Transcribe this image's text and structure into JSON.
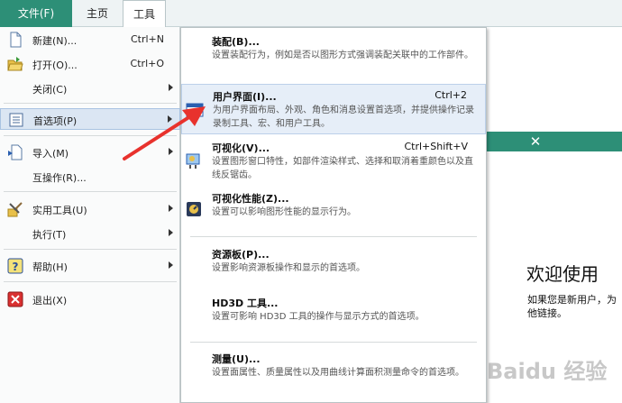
{
  "ribbon": {
    "tab_file": "文件(F)",
    "tab_home": "主页",
    "tab_tools": "工具"
  },
  "file_menu": {
    "items": [
      {
        "label": "新建(N)...",
        "shortcut": "Ctrl+N",
        "icon": "new-document-icon"
      },
      {
        "label": "打开(O)...",
        "shortcut": "Ctrl+O",
        "icon": "open-folder-icon"
      },
      {
        "label": "关闭(C)",
        "icon": "none"
      },
      {
        "label": "首选项(P)",
        "icon": "preferences-icon"
      },
      {
        "label": "导入(M)",
        "icon": "import-icon"
      },
      {
        "label": "互操作(R)...",
        "icon": "none"
      },
      {
        "label": "实用工具(U)",
        "icon": "utilities-icon"
      },
      {
        "label": "执行(T)",
        "icon": "none"
      },
      {
        "label": "帮助(H)",
        "icon": "help-icon"
      },
      {
        "label": "退出(X)",
        "icon": "exit-icon"
      }
    ]
  },
  "submenu": {
    "items": [
      {
        "title": "装配(B)...",
        "shortcut": "",
        "desc": "设置装配行为，例如是否以图形方式强调装配关联中的工作部件。"
      },
      {
        "title": "用户界面(I)...",
        "shortcut": "Ctrl+2",
        "desc": "为用户界面布局、外观、角色和消息设置首选项，并提供操作记录录制工具、宏、和用户工具。"
      },
      {
        "title": "可视化(V)...",
        "shortcut": "Ctrl+Shift+V",
        "desc": "设置图形窗口特性，如部件渲染样式、选择和取消着重颜色以及直线反锯齿。"
      },
      {
        "title": "可视化性能(Z)...",
        "shortcut": "",
        "desc": "设置可以影响图形性能的显示行为。"
      },
      {
        "title": "资源板(P)...",
        "shortcut": "",
        "desc": "设置影响资源板操作和显示的首选项。"
      },
      {
        "title": "HD3D 工具...",
        "shortcut": "",
        "desc": "设置可影响 HD3D 工具的操作与显示方式的首选项。"
      },
      {
        "title": "测量(U)...",
        "shortcut": "",
        "desc": "设置面属性、质量属性以及用曲线计算面积测量命令的首选项。"
      }
    ]
  },
  "background": {
    "close_glyph": "✕",
    "welcome_title": "欢迎使用",
    "welcome_line1": "如果您是新用户，为",
    "welcome_line2": "他链接。",
    "watermark": "Baidu 经验"
  },
  "colors": {
    "accent": "#2d8f77",
    "arrow": "#e8322d",
    "hover": "#dbe6f3"
  }
}
